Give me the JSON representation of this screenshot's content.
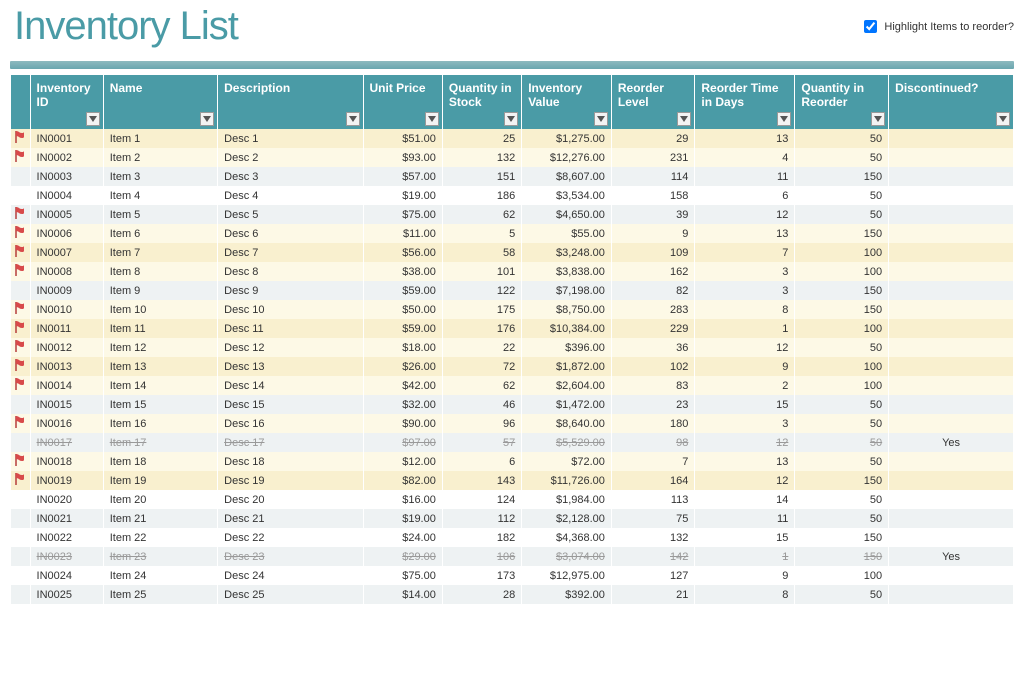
{
  "header": {
    "title": "Inventory List",
    "highlight_label": "Highlight Items to reorder?",
    "highlight_checked": true
  },
  "columns": {
    "inventory_id": "Inventory ID",
    "name": "Name",
    "description": "Description",
    "unit_price": "Unit Price",
    "qty_stock": "Quantity in Stock",
    "inventory_value": "Inventory Value",
    "reorder_level": "Reorder Level",
    "reorder_time": "Reorder Time in Days",
    "qty_reorder": "Quantity in Reorder",
    "discontinued": "Discontinued?"
  },
  "rows": [
    {
      "flag": true,
      "id": "IN0001",
      "name": "Item 1",
      "desc": "Desc 1",
      "price": "$51.00",
      "qty": "25",
      "value": "$1,275.00",
      "reorder": "29",
      "days": "13",
      "qre": "50",
      "disc": "",
      "highlight": true
    },
    {
      "flag": true,
      "id": "IN0002",
      "name": "Item 2",
      "desc": "Desc 2",
      "price": "$93.00",
      "qty": "132",
      "value": "$12,276.00",
      "reorder": "231",
      "days": "4",
      "qre": "50",
      "disc": "",
      "highlight": true
    },
    {
      "flag": false,
      "id": "IN0003",
      "name": "Item 3",
      "desc": "Desc 3",
      "price": "$57.00",
      "qty": "151",
      "value": "$8,607.00",
      "reorder": "114",
      "days": "11",
      "qre": "150",
      "disc": "",
      "highlight": false
    },
    {
      "flag": false,
      "id": "IN0004",
      "name": "Item 4",
      "desc": "Desc 4",
      "price": "$19.00",
      "qty": "186",
      "value": "$3,534.00",
      "reorder": "158",
      "days": "6",
      "qre": "50",
      "disc": "",
      "highlight": false
    },
    {
      "flag": true,
      "id": "IN0005",
      "name": "Item 5",
      "desc": "Desc 5",
      "price": "$75.00",
      "qty": "62",
      "value": "$4,650.00",
      "reorder": "39",
      "days": "12",
      "qre": "50",
      "disc": "",
      "highlight": false
    },
    {
      "flag": true,
      "id": "IN0006",
      "name": "Item 6",
      "desc": "Desc 6",
      "price": "$11.00",
      "qty": "5",
      "value": "$55.00",
      "reorder": "9",
      "days": "13",
      "qre": "150",
      "disc": "",
      "highlight": true
    },
    {
      "flag": true,
      "id": "IN0007",
      "name": "Item 7",
      "desc": "Desc 7",
      "price": "$56.00",
      "qty": "58",
      "value": "$3,248.00",
      "reorder": "109",
      "days": "7",
      "qre": "100",
      "disc": "",
      "highlight": true
    },
    {
      "flag": true,
      "id": "IN0008",
      "name": "Item 8",
      "desc": "Desc 8",
      "price": "$38.00",
      "qty": "101",
      "value": "$3,838.00",
      "reorder": "162",
      "days": "3",
      "qre": "100",
      "disc": "",
      "highlight": true
    },
    {
      "flag": false,
      "id": "IN0009",
      "name": "Item 9",
      "desc": "Desc 9",
      "price": "$59.00",
      "qty": "122",
      "value": "$7,198.00",
      "reorder": "82",
      "days": "3",
      "qre": "150",
      "disc": "",
      "highlight": false
    },
    {
      "flag": true,
      "id": "IN0010",
      "name": "Item 10",
      "desc": "Desc 10",
      "price": "$50.00",
      "qty": "175",
      "value": "$8,750.00",
      "reorder": "283",
      "days": "8",
      "qre": "150",
      "disc": "",
      "highlight": true
    },
    {
      "flag": true,
      "id": "IN0011",
      "name": "Item 11",
      "desc": "Desc 11",
      "price": "$59.00",
      "qty": "176",
      "value": "$10,384.00",
      "reorder": "229",
      "days": "1",
      "qre": "100",
      "disc": "",
      "highlight": true
    },
    {
      "flag": true,
      "id": "IN0012",
      "name": "Item 12",
      "desc": "Desc 12",
      "price": "$18.00",
      "qty": "22",
      "value": "$396.00",
      "reorder": "36",
      "days": "12",
      "qre": "50",
      "disc": "",
      "highlight": true
    },
    {
      "flag": true,
      "id": "IN0013",
      "name": "Item 13",
      "desc": "Desc 13",
      "price": "$26.00",
      "qty": "72",
      "value": "$1,872.00",
      "reorder": "102",
      "days": "9",
      "qre": "100",
      "disc": "",
      "highlight": true
    },
    {
      "flag": true,
      "id": "IN0014",
      "name": "Item 14",
      "desc": "Desc 14",
      "price": "$42.00",
      "qty": "62",
      "value": "$2,604.00",
      "reorder": "83",
      "days": "2",
      "qre": "100",
      "disc": "",
      "highlight": true
    },
    {
      "flag": false,
      "id": "IN0015",
      "name": "Item 15",
      "desc": "Desc 15",
      "price": "$32.00",
      "qty": "46",
      "value": "$1,472.00",
      "reorder": "23",
      "days": "15",
      "qre": "50",
      "disc": "",
      "highlight": false
    },
    {
      "flag": true,
      "id": "IN0016",
      "name": "Item 16",
      "desc": "Desc 16",
      "price": "$90.00",
      "qty": "96",
      "value": "$8,640.00",
      "reorder": "180",
      "days": "3",
      "qre": "50",
      "disc": "",
      "highlight": true
    },
    {
      "flag": false,
      "id": "IN0017",
      "name": "Item 17",
      "desc": "Desc 17",
      "price": "$97.00",
      "qty": "57",
      "value": "$5,529.00",
      "reorder": "98",
      "days": "12",
      "qre": "50",
      "disc": "Yes",
      "highlight": false,
      "discontinued": true
    },
    {
      "flag": true,
      "id": "IN0018",
      "name": "Item 18",
      "desc": "Desc 18",
      "price": "$12.00",
      "qty": "6",
      "value": "$72.00",
      "reorder": "7",
      "days": "13",
      "qre": "50",
      "disc": "",
      "highlight": true
    },
    {
      "flag": true,
      "id": "IN0019",
      "name": "Item 19",
      "desc": "Desc 19",
      "price": "$82.00",
      "qty": "143",
      "value": "$11,726.00",
      "reorder": "164",
      "days": "12",
      "qre": "150",
      "disc": "",
      "highlight": true
    },
    {
      "flag": false,
      "id": "IN0020",
      "name": "Item 20",
      "desc": "Desc 20",
      "price": "$16.00",
      "qty": "124",
      "value": "$1,984.00",
      "reorder": "113",
      "days": "14",
      "qre": "50",
      "disc": "",
      "highlight": false
    },
    {
      "flag": false,
      "id": "IN0021",
      "name": "Item 21",
      "desc": "Desc 21",
      "price": "$19.00",
      "qty": "112",
      "value": "$2,128.00",
      "reorder": "75",
      "days": "11",
      "qre": "50",
      "disc": "",
      "highlight": false
    },
    {
      "flag": false,
      "id": "IN0022",
      "name": "Item 22",
      "desc": "Desc 22",
      "price": "$24.00",
      "qty": "182",
      "value": "$4,368.00",
      "reorder": "132",
      "days": "15",
      "qre": "150",
      "disc": "",
      "highlight": false
    },
    {
      "flag": false,
      "id": "IN0023",
      "name": "Item 23",
      "desc": "Desc 23",
      "price": "$29.00",
      "qty": "106",
      "value": "$3,074.00",
      "reorder": "142",
      "days": "1",
      "qre": "150",
      "disc": "Yes",
      "highlight": false,
      "discontinued": true
    },
    {
      "flag": false,
      "id": "IN0024",
      "name": "Item 24",
      "desc": "Desc 24",
      "price": "$75.00",
      "qty": "173",
      "value": "$12,975.00",
      "reorder": "127",
      "days": "9",
      "qre": "100",
      "disc": "",
      "highlight": false
    },
    {
      "flag": false,
      "id": "IN0025",
      "name": "Item 25",
      "desc": "Desc 25",
      "price": "$14.00",
      "qty": "28",
      "value": "$392.00",
      "reorder": "21",
      "days": "8",
      "qre": "50",
      "disc": "",
      "highlight": false
    }
  ],
  "icons": {
    "flag_svg": "flag-icon"
  }
}
